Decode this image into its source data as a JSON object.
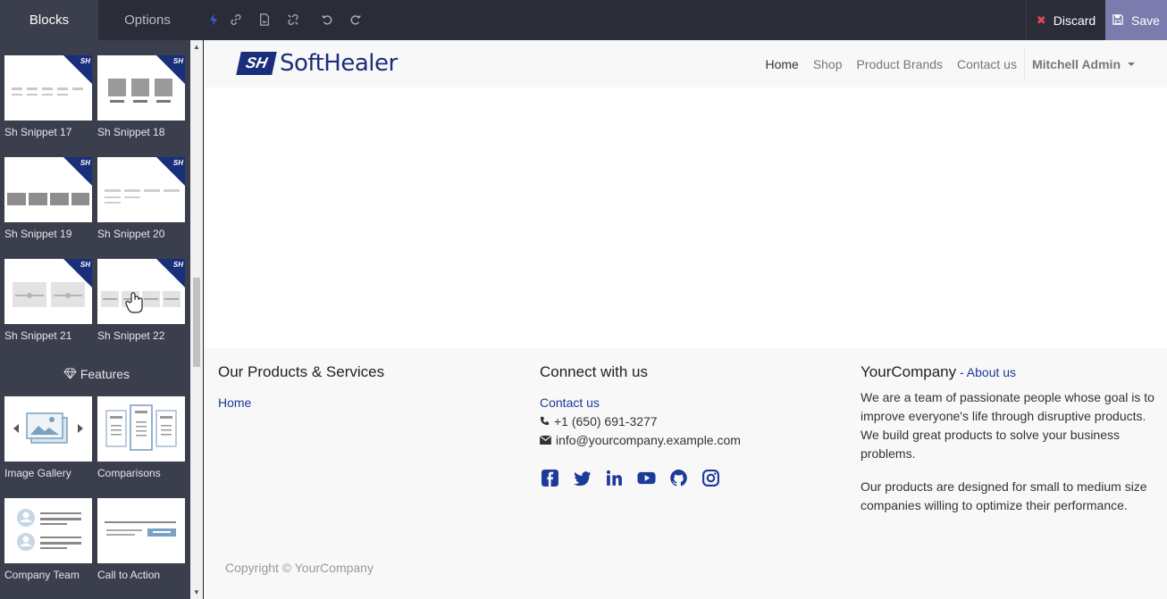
{
  "colors": {
    "topbar_bg": "#2a2c38",
    "sidebar_bg": "#3b3e4d",
    "save_bg": "#7c7bad",
    "discard_icon": "#e0475a",
    "brand": "#1a2f7a",
    "link": "#1b3a9a"
  },
  "topbar": {
    "tabs": [
      {
        "label": "Blocks",
        "active": true
      },
      {
        "label": "Options",
        "active": false
      }
    ],
    "tools": [
      {
        "icon": "bolt-icon"
      },
      {
        "icon": "link-icon"
      },
      {
        "icon": "image-icon"
      },
      {
        "icon": "unlink-icon"
      },
      {
        "icon": "undo-icon"
      },
      {
        "icon": "redo-icon"
      }
    ],
    "discard_label": "Discard",
    "save_label": "Save"
  },
  "sidebar": {
    "snippets": [
      {
        "label": "Sh Snippet 17",
        "badge": "SH"
      },
      {
        "label": "Sh Snippet 18",
        "badge": "SH"
      },
      {
        "label": "Sh Snippet 19",
        "badge": "SH"
      },
      {
        "label": "Sh Snippet 20",
        "badge": "SH"
      },
      {
        "label": "Sh Snippet 21",
        "badge": "SH"
      },
      {
        "label": "Sh Snippet 22",
        "badge": "SH"
      }
    ],
    "features_title": "Features",
    "features": [
      {
        "label": "Image Gallery"
      },
      {
        "label": "Comparisons"
      },
      {
        "label": "Company Team"
      },
      {
        "label": "Call to Action"
      }
    ]
  },
  "site": {
    "logo_mark": "SH",
    "logo_text": "SoftHealer",
    "nav": [
      {
        "label": "Home",
        "active": true
      },
      {
        "label": "Shop",
        "active": false
      },
      {
        "label": "Product Brands",
        "active": false
      },
      {
        "label": "Contact us",
        "active": false
      }
    ],
    "user": "Mitchell Admin"
  },
  "footer": {
    "col1": {
      "title": "Our Products & Services",
      "link": "Home"
    },
    "col2": {
      "title": "Connect with us",
      "link": "Contact us",
      "phone": "+1 (650) 691-3277",
      "email": "info@yourcompany.example.com",
      "social": [
        "facebook-icon",
        "twitter-icon",
        "linkedin-icon",
        "youtube-icon",
        "github-icon",
        "instagram-icon"
      ]
    },
    "col3": {
      "title": "YourCompany",
      "title_sep": " - ",
      "title_link": "About us",
      "para1": "We are a team of passionate people whose goal is to improve everyone's life through disruptive products. We build great products to solve your business problems.",
      "para2": "Our products are designed for small to medium size companies willing to optimize their performance."
    },
    "copyright": "Copyright © YourCompany"
  }
}
